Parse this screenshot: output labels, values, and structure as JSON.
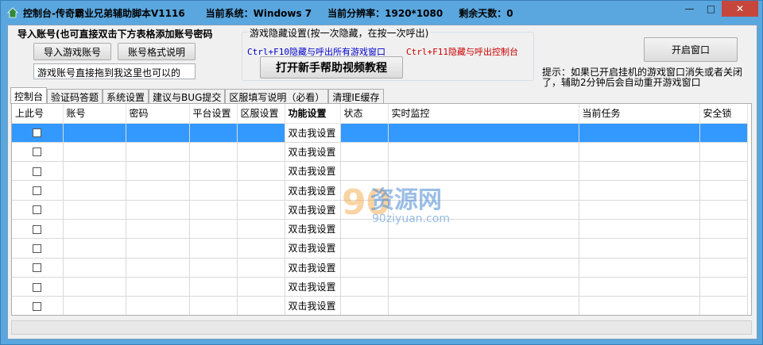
{
  "titlebar": {
    "app_title": "控制台-传奇霸业兄弟辅助脚本V1116",
    "system": "当前系统：Windows 7",
    "resolution": "当前分辨率：1920*1080",
    "days_left": "剩余天数：0",
    "minimize": "—",
    "maximize": "□",
    "close": "✕"
  },
  "import_group": {
    "label": "导入账号(也可直接双击下方表格添加账号密码",
    "import_button": "导入游戏账号",
    "format_button": "账号格式说明",
    "drag_hint": "游戏账号直接拖到我这里也可以的"
  },
  "hide_group": {
    "legend": "游戏隐藏设置(按一次隐藏，在按一次呼出)",
    "hotkey_all": "Ctrl+F10隐藏与呼出所有游戏窗口",
    "hotkey_console": "Ctrl+F11隐藏与呼出控制台",
    "tutorial_button": "打开新手帮助视频教程"
  },
  "open_window_button": "开启窗口",
  "hint_text": "提示：如果已开启挂机的游戏窗口消失或者关闭了，辅助2分钟后会自动重开游戏窗口",
  "tabs": [
    "控制台",
    "验证码答题",
    "系统设置",
    "建议与BUG提交",
    "区服填写说明（必看）",
    "清理IE缓存"
  ],
  "table": {
    "columns": [
      "上此号",
      "账号",
      "密码",
      "平台设置",
      "区服设置",
      "功能设置",
      "状态",
      "实时监控",
      "当前任务",
      "安全锁"
    ],
    "rows": [
      {
        "func": "双击我设置"
      },
      {
        "func": "双击我设置"
      },
      {
        "func": "双击我设置"
      },
      {
        "func": "双击我设置"
      },
      {
        "func": "双击我设置"
      },
      {
        "func": "双击我设置"
      },
      {
        "func": "双击我设置"
      },
      {
        "func": "双击我设置"
      },
      {
        "func": "双击我设置"
      },
      {
        "func": "双击我设置"
      }
    ]
  },
  "watermark": {
    "brand": "资源网",
    "domain": "90ziyuan.com",
    "digits": "90"
  },
  "colors": {
    "titlebar": "#5aa7df",
    "selection": "#3399ff",
    "close": "#c7463c",
    "hotkey_blue": "#0000cc",
    "hotkey_red": "#cc0000"
  }
}
